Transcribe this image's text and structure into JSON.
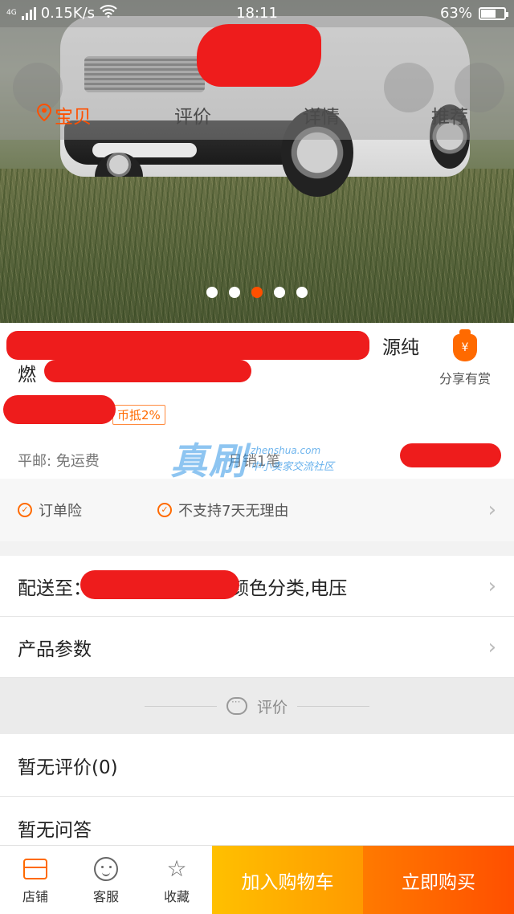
{
  "status_bar": {
    "network": "4G",
    "speed": "0.15K/s",
    "time": "18:11",
    "battery_percent": "63%",
    "battery_level": 0.63
  },
  "tabs": [
    {
      "label": "宝贝",
      "active": true
    },
    {
      "label": "评价",
      "active": false
    },
    {
      "label": "详情",
      "active": false
    },
    {
      "label": "推荐",
      "active": false
    }
  ],
  "carousel": {
    "count": 5,
    "active_index": 2,
    "accent": "#ff5000"
  },
  "product": {
    "title_line1": "源纯",
    "title_line2": "燃",
    "coupon": "币抵2%",
    "share_label": "分享有赏",
    "shipping": "平邮: 免运费",
    "monthly_sales": "月销1笔"
  },
  "watermark": {
    "big": "真刷",
    "url": "zhenshua.com",
    "sub": "中小卖家交流社区"
  },
  "guarantees": [
    {
      "label": "订单险"
    },
    {
      "label": "不支持7天无理由"
    }
  ],
  "rows": {
    "delivery_prefix": "配送至：",
    "delivery_suffix": "择颜色分类,电压",
    "params": "产品参数",
    "rating_header": "评价",
    "no_reviews": "暂无评价(0)",
    "no_qa": "暂无问答"
  },
  "bottom_bar": {
    "shop": "店铺",
    "service": "客服",
    "favorite": "收藏",
    "add_to_cart": "加入购物车",
    "buy_now": "立即购买"
  },
  "colors": {
    "accent": "#ff5000",
    "cart_button": "#ffa800",
    "buy_button": "#ff5a00"
  }
}
